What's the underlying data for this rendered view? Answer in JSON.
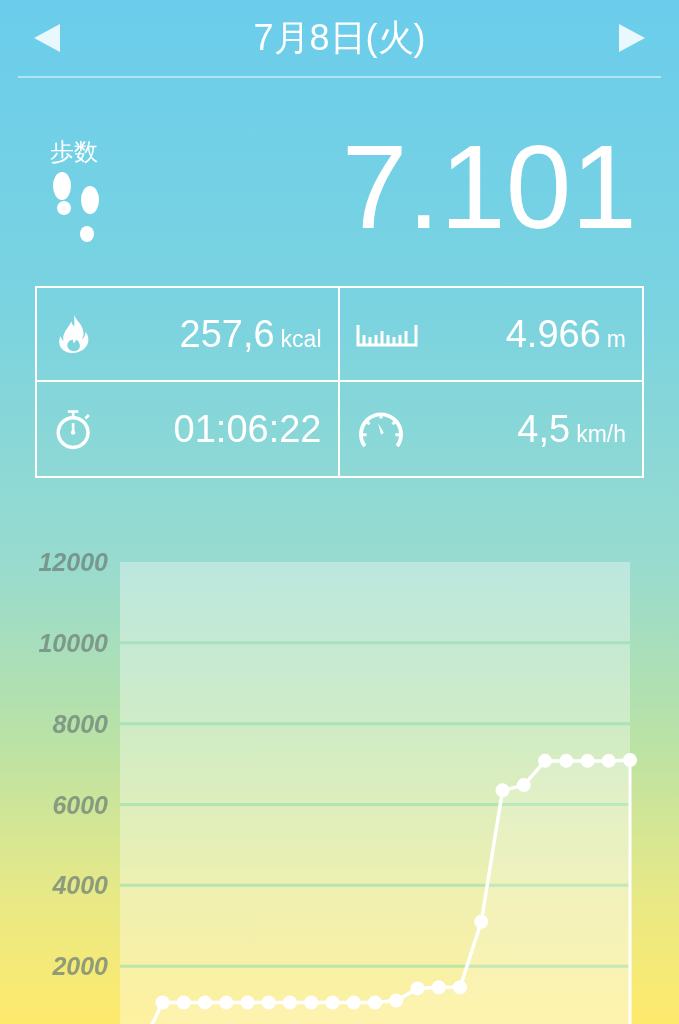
{
  "header": {
    "title": "7月8日(火)"
  },
  "steps": {
    "label": "歩数",
    "value": "7.101"
  },
  "stats": [
    {
      "kind": "calories",
      "value": "257,6",
      "unit": "kcal"
    },
    {
      "kind": "distance",
      "value": "4.966",
      "unit": "m"
    },
    {
      "kind": "time",
      "value": "01:06:22"
    },
    {
      "kind": "speed",
      "value": "4,5",
      "unit": "km/h"
    }
  ],
  "chart": {
    "chart_data": {
      "type": "area",
      "categories": [
        null,
        null,
        null,
        null,
        null,
        null,
        null,
        null,
        null,
        null,
        null,
        null,
        null,
        null,
        null,
        null,
        null,
        null,
        null,
        null,
        null,
        null,
        null,
        null
      ],
      "series": [
        {
          "color": "#ffffff",
          "values": [
            0,
            1100,
            1100,
            1100,
            1100,
            1100,
            1100,
            1100,
            1100,
            1100,
            1100,
            1100,
            1150,
            1450,
            1480,
            1480,
            3100,
            6350,
            6480,
            7080,
            7080,
            7080,
            7080,
            7100
          ]
        }
      ],
      "grid": true,
      "ylim": [
        0,
        12000
      ],
      "yticks": [
        2000,
        4000,
        6000,
        8000,
        10000,
        12000
      ]
    }
  }
}
